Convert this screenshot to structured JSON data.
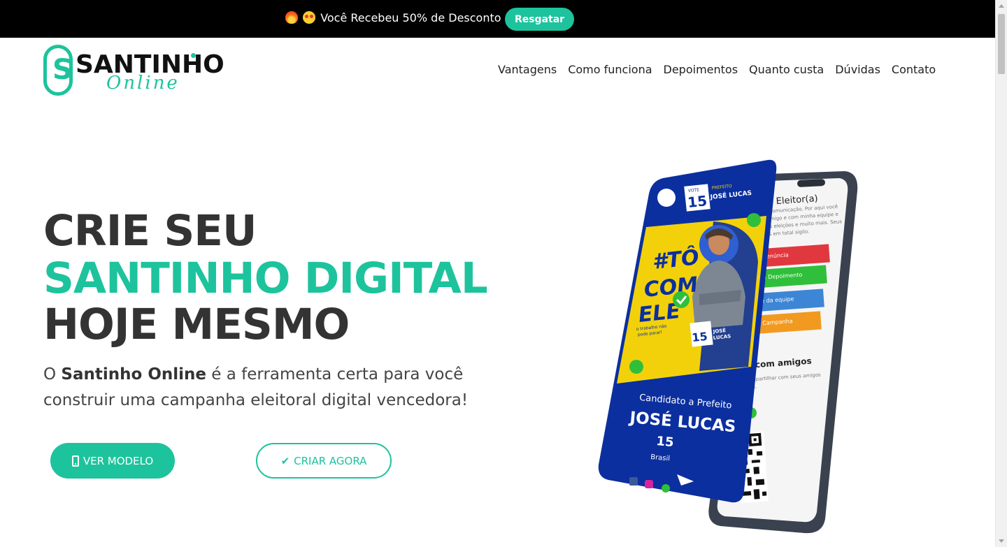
{
  "promo": {
    "text": "Você Recebeu 50% de Desconto !",
    "button": "Resgatar",
    "emojis": [
      "fire-emoji",
      "heart-eyes-emoji"
    ]
  },
  "logo": {
    "letter": "S",
    "word": "SANTINHO",
    "sub": "Online"
  },
  "nav": {
    "items": [
      "Vantagens",
      "Como funciona",
      "Depoimentos",
      "Quanto custa",
      "Dúvidas",
      "Contato"
    ]
  },
  "hero": {
    "line1": "CRIE SEU",
    "line2": "SANTINHO DIGITAL",
    "line3": "HOJE MESMO",
    "desc_pre": "O ",
    "desc_bold": "Santinho Online",
    "desc_post": " é a ferramenta certa para você construir uma campanha eleitoral digital vencedora!",
    "btn_primary": "VER MODELO",
    "btn_outline": "CRIAR AGORA"
  },
  "mockup": {
    "card_vote_label": "VOTE",
    "card_number": "15",
    "card_role_small": "PREFEITO",
    "card_name_small": "JOSÉ LUCAS",
    "hashtag": "#TÔ COM ELE",
    "slogan": "o trabalho não pode parar!",
    "candidate_role": "Candidato a Prefeito",
    "candidate_name": "JOSÉ LUCAS",
    "candidate_number": "15",
    "candidate_country": "Brasil",
    "screen_title": "o Eleitor(a)",
    "screen_text": "e comunicação. Por aqui você comigo e com minha equipe e das eleições e muito mais. Seus dos em total sigilo.",
    "screen_buttons": [
      "Denúncia",
      "ou Depoimento",
      "rte da equipe",
      "de Campanha"
    ],
    "screen_share_title": "e com amigos",
    "screen_share_text": "compartilhar com seus amigos inho.",
    "colors": {
      "brand": "#1dc39c",
      "blue": "#0b2f9f",
      "yellow": "#f2d10b",
      "red": "#e0383e",
      "green": "#2fbf3a",
      "lightblue": "#3d86d6",
      "orange": "#f19a1f"
    }
  }
}
